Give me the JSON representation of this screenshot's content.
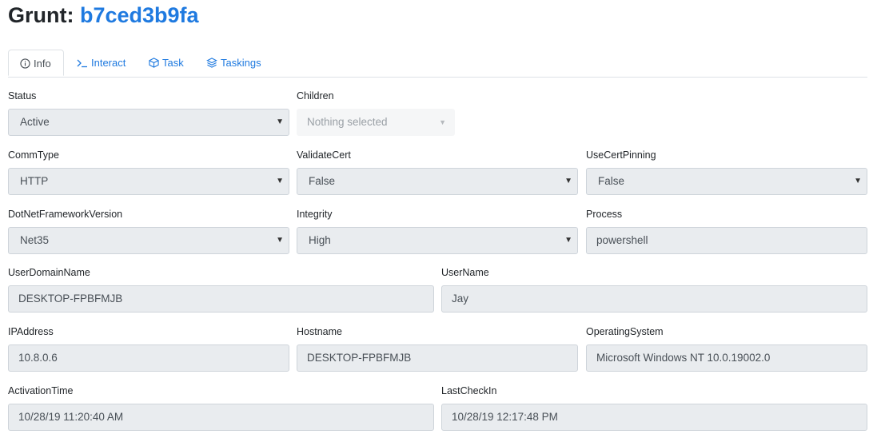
{
  "header": {
    "label": "Grunt:",
    "grunt_id": "b7ced3b9fa"
  },
  "tabs": [
    {
      "label": "Info",
      "icon": "info-circle-icon",
      "active": true
    },
    {
      "label": "Interact",
      "icon": "terminal-prompt-icon",
      "active": false
    },
    {
      "label": "Task",
      "icon": "cube-icon",
      "active": false
    },
    {
      "label": "Taskings",
      "icon": "layers-icon",
      "active": false
    }
  ],
  "fields": {
    "status": {
      "label": "Status",
      "value": "Active"
    },
    "children": {
      "label": "Children",
      "placeholder": "Nothing selected"
    },
    "commtype": {
      "label": "CommType",
      "value": "HTTP"
    },
    "validatecert": {
      "label": "ValidateCert",
      "value": "False"
    },
    "usecertpinning": {
      "label": "UseCertPinning",
      "value": "False"
    },
    "dotnet": {
      "label": "DotNetFrameworkVersion",
      "value": "Net35"
    },
    "integrity": {
      "label": "Integrity",
      "value": "High"
    },
    "process": {
      "label": "Process",
      "value": "powershell"
    },
    "userdomainname": {
      "label": "UserDomainName",
      "value": "DESKTOP-FPBFMJB"
    },
    "username": {
      "label": "UserName",
      "value": "Jay"
    },
    "ipaddress": {
      "label": "IPAddress",
      "value": "10.8.0.6"
    },
    "hostname": {
      "label": "Hostname",
      "value": "DESKTOP-FPBFMJB"
    },
    "operatingsystem": {
      "label": "OperatingSystem",
      "value": "Microsoft Windows NT 10.0.19002.0"
    },
    "activationtime": {
      "label": "ActivationTime",
      "value": "10/28/19 11:20:40 AM"
    },
    "lastcheckin": {
      "label": "LastCheckIn",
      "value": "10/28/19 12:17:48 PM"
    }
  },
  "colors": {
    "link": "#1f7ae0",
    "control_bg": "#e9ecef",
    "border": "#ced4da"
  }
}
